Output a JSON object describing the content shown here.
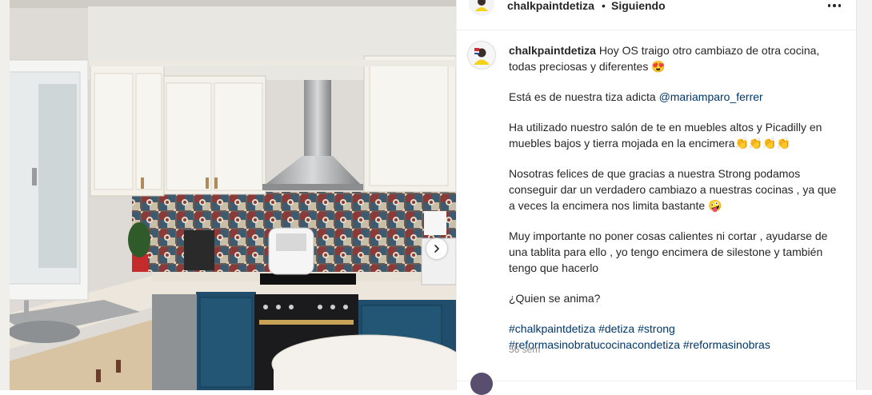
{
  "post": {
    "username": "chalkpaintdetiza",
    "separator": "•",
    "follow_status": "Siguiendo",
    "caption": {
      "intro": "Hoy OS traigo otro cambiazo de otra cocina, todas preciosas y diferentes 😍",
      "p2_prefix": "Está es de nuestra tiza adicta ",
      "p2_mention": "@mariamparo_ferrer",
      "p3": "Ha utilizado nuestro salón de te en muebles altos y Picadilly en muebles bajos y tierra mojada en la encimera👏👏👏👏",
      "p4": "Nosotras felices de que gracias a nuestra Strong podamos conseguir dar un verdadero cambiazo a nuestras cocinas , ya que a veces la encimera nos limita bastante 🤪",
      "p5": "Muy importante no poner cosas calientes ni cortar , ayudarse de una tablita para ello , yo tengo encimera de silestone y también tengo que hacerlo",
      "p6": "¿Quien se anima?",
      "hashtags": [
        "#chalkpaintdetiza",
        "#detiza",
        "#strong",
        "#reformasinobratucocinacondetiza",
        "#reformasinobras"
      ]
    },
    "time_ago": "56 sem"
  },
  "icons": {
    "more": "more-options-icon",
    "next": "chevron-right-icon"
  },
  "colors": {
    "link": "#00376b",
    "text": "#262626",
    "muted": "#8e8e8e",
    "cabinet_blue": "#1f4d6b",
    "cabinet_white": "#f3f1ea"
  }
}
